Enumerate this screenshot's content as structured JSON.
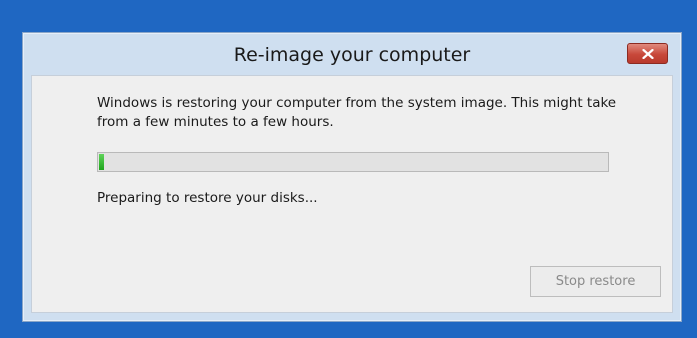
{
  "window": {
    "title": "Re-image your computer",
    "close_icon": "close-icon"
  },
  "content": {
    "message": "Windows is restoring your computer from the system image. This might take\nfrom a few minutes to a few hours.",
    "progress_percent": 1,
    "status": "Preparing to restore your disks...",
    "stop_button_label": "Stop restore",
    "stop_button_enabled": false
  },
  "colors": {
    "desktop": "#1f67c2",
    "close_button": "#c8483a",
    "progress_fill": "#1fa51c"
  }
}
